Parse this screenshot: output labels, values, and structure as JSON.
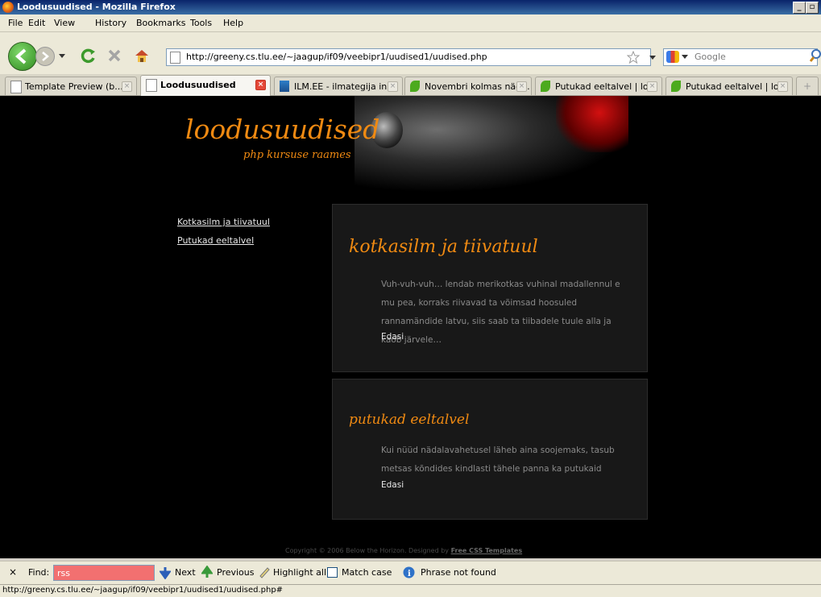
{
  "window": {
    "title": "Loodusuudised - Mozilla Firefox"
  },
  "menu": [
    "File",
    "Edit",
    "View",
    "History",
    "Bookmarks",
    "Tools",
    "Help"
  ],
  "nav": {
    "url": "http://greeny.cs.tlu.ee/~jaagup/if09/veebipr1/uudised1/uudised.php",
    "search_placeholder": "Google"
  },
  "tabs": [
    {
      "label": "Template Preview (b...",
      "active": false
    },
    {
      "label": "Loodusuudised",
      "active": true
    },
    {
      "label": "ILM.EE - ilmategija in...",
      "active": false
    },
    {
      "label": "Novembri kolmas näd...",
      "active": false
    },
    {
      "label": "Putukad eeltalvel | lo...",
      "active": false
    },
    {
      "label": "Putukad eeltalvel | lo...",
      "active": false
    }
  ],
  "site": {
    "title": "loodusuudised",
    "subtitle": "php kursuse raames",
    "sidebar_links": [
      "Kotkasilm ja tiivatuul",
      "Putukad eeltalvel"
    ],
    "posts": [
      {
        "title": "kotkasilm ja tiivatuul",
        "body": "Vuh-vuh-vuh… lendab merikotkas vuhinal madallennul e mu pea, korraks riivavad ta võimsad hoosuled rannamändide latvu, siis saab ta tiibadele tuule alla ja kaob järvele…",
        "more": "Edasi"
      },
      {
        "title": "putukad eeltalvel",
        "body": "Kui nüüd nädalavahetusel läheb aina soojemaks, tasub metsas kõndides kindlasti tähele panna ka putukaid",
        "more": "Edasi"
      }
    ],
    "copyright_text": "Copyright © 2006 Below the Horizon. Designed by",
    "copyright_link": "Free CSS Templates"
  },
  "findbar": {
    "label": "Find:",
    "value": "rss",
    "next": "Next",
    "previous": "Previous",
    "highlight": "Highlight all",
    "match_case": "Match case",
    "status": "Phrase not found"
  },
  "status_url": "http://greeny.cs.tlu.ee/~jaagup/if09/veebipr1/uudised1/uudised.php#"
}
